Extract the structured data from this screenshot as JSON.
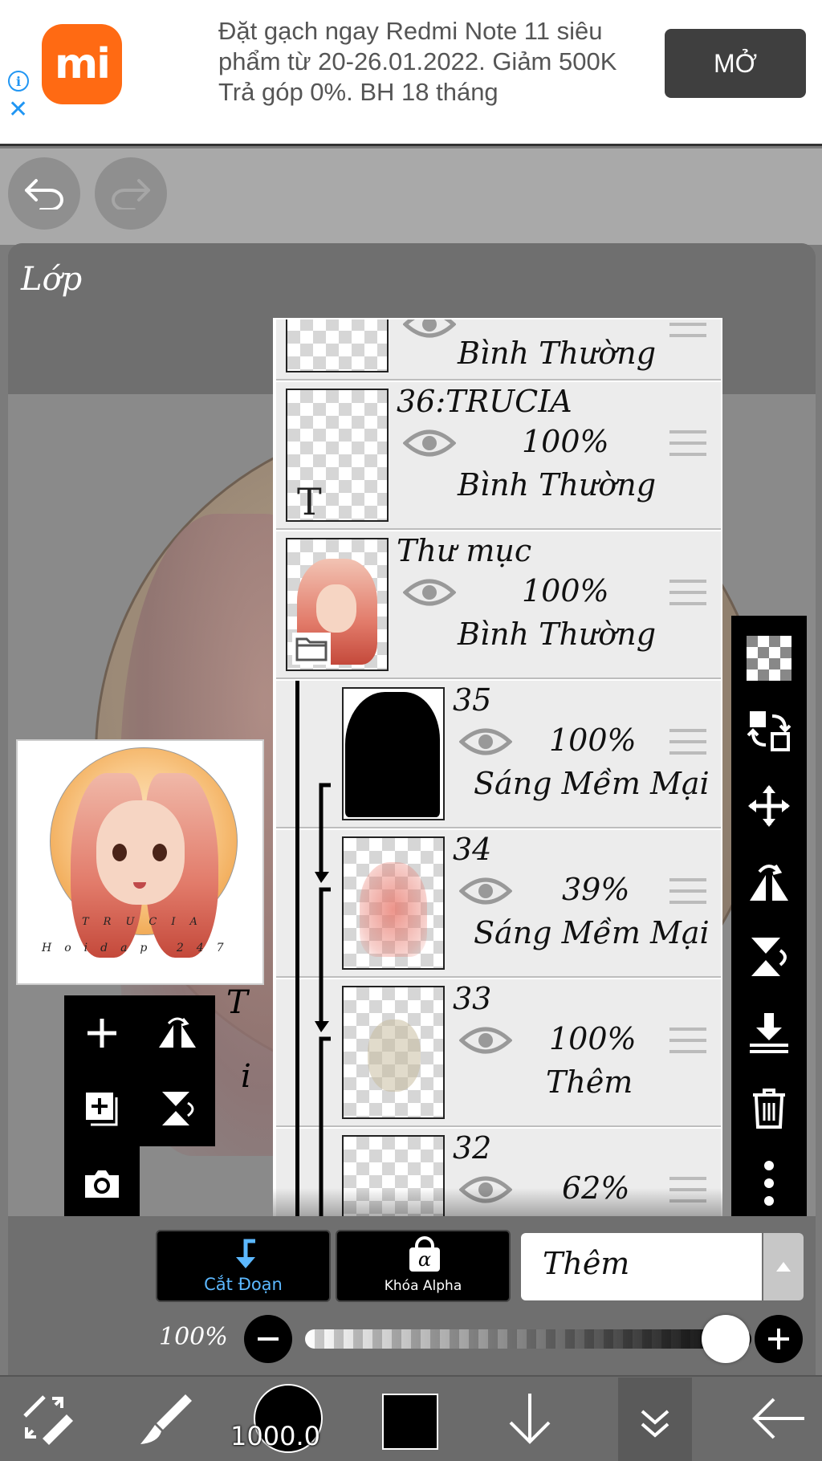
{
  "ad": {
    "text": "Đặt gạch ngay Redmi Note 11 siêu\nphẩm từ 20-26.01.2022. Giảm 500K\nTrả góp 0%. BH 18 tháng",
    "button_label": "MỞ",
    "logo_text": "mi",
    "info_glyph": "i",
    "close_glyph": "✕"
  },
  "panel": {
    "title": "Lớp"
  },
  "layers": [
    {
      "name": "",
      "opacity": "",
      "blend": "Bình Thường"
    },
    {
      "name": "36:TRUCIA",
      "opacity": "100%",
      "blend": "Bình Thường"
    },
    {
      "name": "Thư mục",
      "opacity": "100%",
      "blend": "Bình Thường"
    },
    {
      "name": "35",
      "opacity": "100%",
      "blend": "Sáng Mềm Mại"
    },
    {
      "name": "34",
      "opacity": "39%",
      "blend": "Sáng Mềm Mại"
    },
    {
      "name": "33",
      "opacity": "100%",
      "blend": "Thêm"
    },
    {
      "name": "32",
      "opacity": "62%",
      "blend": ""
    }
  ],
  "preview": {
    "line1": "TRUCIA",
    "line2": "Hoidap 247"
  },
  "canvas_marks": {
    "t": "T",
    "i": "i"
  },
  "controls": {
    "clip_label": "Cắt Đoạn",
    "alpha_label": "Khóa Alpha",
    "alpha_glyph": "α",
    "blend_mode": "Thêm",
    "opacity_label": "100%",
    "opacity_value": 1.0
  },
  "bottom_nav": {
    "brush_size": "1000.0"
  },
  "colors": {
    "accent": "#5cb8ff",
    "ad_brand": "#ff6a13"
  }
}
